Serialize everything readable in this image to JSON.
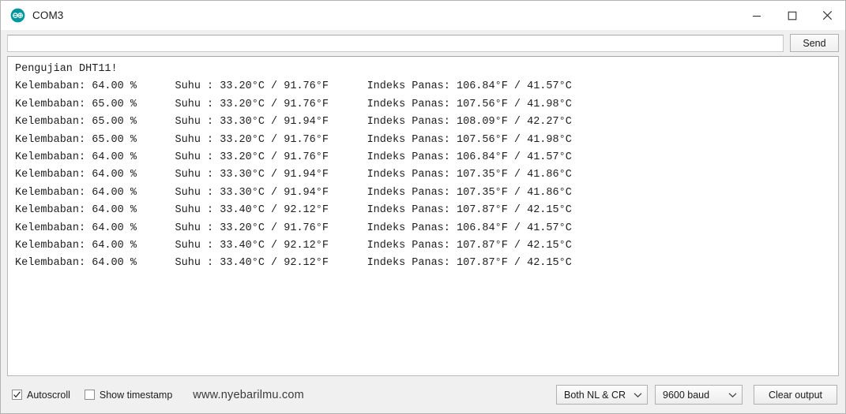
{
  "window": {
    "title": "COM3",
    "icon": "arduino-logo-icon",
    "controls": {
      "minimize": "minimize-icon",
      "maximize": "maximize-icon",
      "close": "close-icon"
    }
  },
  "send_row": {
    "input_value": "",
    "input_placeholder": "",
    "send_label": "Send"
  },
  "output": {
    "header_line": "Pengujian DHT11!",
    "lines": [
      "Pengujian DHT11!",
      "Kelembaban: 64.00 %      Suhu : 33.20°C / 91.76°F      Indeks Panas: 106.84°F / 41.57°C",
      "Kelembaban: 65.00 %      Suhu : 33.20°C / 91.76°F      Indeks Panas: 107.56°F / 41.98°C",
      "Kelembaban: 65.00 %      Suhu : 33.30°C / 91.94°F      Indeks Panas: 108.09°F / 42.27°C",
      "Kelembaban: 65.00 %      Suhu : 33.20°C / 91.76°F      Indeks Panas: 107.56°F / 41.98°C",
      "Kelembaban: 64.00 %      Suhu : 33.20°C / 91.76°F      Indeks Panas: 106.84°F / 41.57°C",
      "Kelembaban: 64.00 %      Suhu : 33.30°C / 91.94°F      Indeks Panas: 107.35°F / 41.86°C",
      "Kelembaban: 64.00 %      Suhu : 33.30°C / 91.94°F      Indeks Panas: 107.35°F / 41.86°C",
      "Kelembaban: 64.00 %      Suhu : 33.40°C / 92.12°F      Indeks Panas: 107.87°F / 42.15°C",
      "Kelembaban: 64.00 %      Suhu : 33.20°C / 91.76°F      Indeks Panas: 106.84°F / 41.57°C",
      "Kelembaban: 64.00 %      Suhu : 33.40°C / 92.12°F      Indeks Panas: 107.87°F / 42.15°C",
      "Kelembaban: 64.00 %      Suhu : 33.40°C / 92.12°F      Indeks Panas: 107.87°F / 42.15°C"
    ],
    "text": "Pengujian DHT11!\nKelembaban: 64.00 %      Suhu : 33.20°C / 91.76°F      Indeks Panas: 106.84°F / 41.57°C\nKelembaban: 65.00 %      Suhu : 33.20°C / 91.76°F      Indeks Panas: 107.56°F / 41.98°C\nKelembaban: 65.00 %      Suhu : 33.30°C / 91.94°F      Indeks Panas: 108.09°F / 42.27°C\nKelembaban: 65.00 %      Suhu : 33.20°C / 91.76°F      Indeks Panas: 107.56°F / 41.98°C\nKelembaban: 64.00 %      Suhu : 33.20°C / 91.76°F      Indeks Panas: 106.84°F / 41.57°C\nKelembaban: 64.00 %      Suhu : 33.30°C / 91.94°F      Indeks Panas: 107.35°F / 41.86°C\nKelembaban: 64.00 %      Suhu : 33.30°C / 91.94°F      Indeks Panas: 107.35°F / 41.86°C\nKelembaban: 64.00 %      Suhu : 33.40°C / 92.12°F      Indeks Panas: 107.87°F / 42.15°C\nKelembaban: 64.00 %      Suhu : 33.20°C / 91.76°F      Indeks Panas: 106.84°F / 41.57°C\nKelembaban: 64.00 %      Suhu : 33.40°C / 92.12°F      Indeks Panas: 107.87°F / 42.15°C\nKelembaban: 64.00 %      Suhu : 33.40°C / 92.12°F      Indeks Panas: 107.87°F / 42.15°C",
    "readings": [
      {
        "humidity": "64.00",
        "temp_c": "33.20",
        "temp_f": "91.76",
        "heat_index_f": "106.84",
        "heat_index_c": "41.57"
      },
      {
        "humidity": "65.00",
        "temp_c": "33.20",
        "temp_f": "91.76",
        "heat_index_f": "107.56",
        "heat_index_c": "41.98"
      },
      {
        "humidity": "65.00",
        "temp_c": "33.30",
        "temp_f": "91.94",
        "heat_index_f": "108.09",
        "heat_index_c": "42.27"
      },
      {
        "humidity": "65.00",
        "temp_c": "33.20",
        "temp_f": "91.76",
        "heat_index_f": "107.56",
        "heat_index_c": "41.98"
      },
      {
        "humidity": "64.00",
        "temp_c": "33.20",
        "temp_f": "91.76",
        "heat_index_f": "106.84",
        "heat_index_c": "41.57"
      },
      {
        "humidity": "64.00",
        "temp_c": "33.30",
        "temp_f": "91.94",
        "heat_index_f": "107.35",
        "heat_index_c": "41.86"
      },
      {
        "humidity": "64.00",
        "temp_c": "33.30",
        "temp_f": "91.94",
        "heat_index_f": "107.35",
        "heat_index_c": "41.86"
      },
      {
        "humidity": "64.00",
        "temp_c": "33.40",
        "temp_f": "92.12",
        "heat_index_f": "107.87",
        "heat_index_c": "42.15"
      },
      {
        "humidity": "64.00",
        "temp_c": "33.20",
        "temp_f": "91.76",
        "heat_index_f": "106.84",
        "heat_index_c": "41.57"
      },
      {
        "humidity": "64.00",
        "temp_c": "33.40",
        "temp_f": "92.12",
        "heat_index_f": "107.87",
        "heat_index_c": "42.15"
      },
      {
        "humidity": "64.00",
        "temp_c": "33.40",
        "temp_f": "92.12",
        "heat_index_f": "107.87",
        "heat_index_c": "42.15"
      }
    ]
  },
  "statusbar": {
    "autoscroll_label": "Autoscroll",
    "autoscroll_checked": true,
    "timestamp_label": "Show timestamp",
    "timestamp_checked": false,
    "watermark": "www.nyebarilmu.com",
    "line_ending": "Both NL & CR",
    "baud_rate": "9600 baud",
    "clear_label": "Clear output"
  },
  "colors": {
    "arduino_teal": "#00979c",
    "chrome_bg": "#f0f0f0",
    "text": "#1e1e1e",
    "border": "#b4b4b4"
  }
}
